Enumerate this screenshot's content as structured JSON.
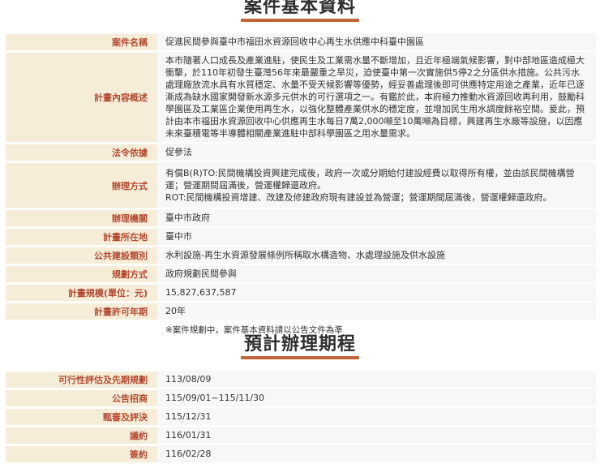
{
  "section1": {
    "title": "案件基本資料",
    "rows": {
      "case_name": {
        "label": "案件名稱",
        "value": "促進民間參與臺中市福田水資源回收中心再生水供應中科臺中園區"
      },
      "summary": {
        "label": "計畫內容概述",
        "value": "本市隨著人口成長及產業進駐，使民生及工業需水量不斷增加，且近年極端氣候影響，對中部地區造成極大衝擊，於110年初發生臺灣56年來最嚴重之旱災，迫使臺中第一次實施供5停2之分區供水措施。公共污水處理廠放流水具有水質穩定、水量不受天候影響等優勢，經妥善處理後即可供應特定用途之產業，近年已逐漸成為缺水國家開發新水源多元供水的可行選項之一。有鑑於此，本府極力推動水資源回收再利用，鼓勵科學園區及工業區企業使用再生水，以強化整體產業供水的穩定度，並增加民生用水調度餘裕空間。爰此，預計由本市福田水資源回收中心供應再生水每日7萬2,000噸至10萬噸為目標，興建再生水廠等設施，以因應未來臺積電等半導體相關產業進駐中部科學園區之用水量需求。"
      },
      "legal_basis": {
        "label": "法令依據",
        "value": "促參法"
      },
      "method": {
        "label": "辦理方式",
        "line1": "有償B(R)TO:民間機構投資興建完成後，政府一次或分期給付建設經費以取得所有權，並由該民間機構營運；營運期間屆滿後，營運權歸還政府。",
        "line2": "ROT:民間機構投資增建、改建及修建政府現有建設並為營運；營運期間屆滿後，營運權歸還政府。"
      },
      "agency": {
        "label": "辦理機關",
        "value": "臺中市政府"
      },
      "location": {
        "label": "計畫所在地",
        "value": "臺中市"
      },
      "category": {
        "label": "公共建設類別",
        "value": "水利設施-再生水資源發展條例所稱取水構造物、水處理設施及供水設施"
      },
      "planning": {
        "label": "規劃方式",
        "value": "政府規劃民間參與"
      },
      "scale": {
        "label": "計畫規模(單位：元)",
        "value": "15,827,637,587"
      },
      "years": {
        "label": "計畫許可年期",
        "value": "20年"
      }
    },
    "note": "※案件規劃中，案件基本資料請以公告文件為準"
  },
  "section2": {
    "title": "預計辦理期程",
    "rows": [
      {
        "label": "可行性評估及先期規劃",
        "value": "113/08/09"
      },
      {
        "label": "公告招商",
        "value": "115/09/01~115/11/30"
      },
      {
        "label": "甄審及評決",
        "value": "115/12/31"
      },
      {
        "label": "議約",
        "value": "116/01/31"
      },
      {
        "label": "簽約",
        "value": "116/02/28"
      }
    ]
  }
}
